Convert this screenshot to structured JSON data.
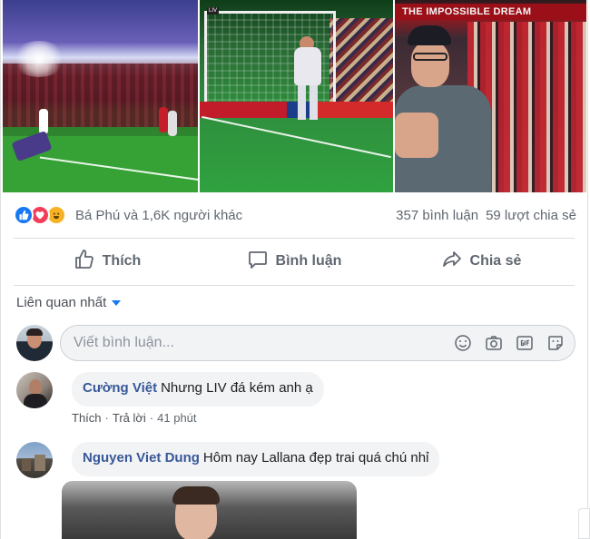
{
  "photos": [
    {
      "name": "stadium-photo"
    },
    {
      "name": "goal-celebration-photo",
      "badge": "LIV"
    },
    {
      "name": "manager-photo",
      "banner": "THE IMPOSSIBLE DREAM"
    }
  ],
  "stats": {
    "reactions": [
      "like-icon",
      "love-icon",
      "haha-icon"
    ],
    "reactors": "Bá Phú và 1,6K người khác",
    "comments": "357 bình luận",
    "shares": "59 lượt chia sẻ"
  },
  "actions": {
    "like": "Thích",
    "comment": "Bình luận",
    "share": "Chia sẻ"
  },
  "sort": {
    "label": "Liên quan nhất"
  },
  "composer": {
    "placeholder": "Viết bình luận...",
    "icons": [
      "emoji-icon",
      "camera-icon",
      "gif-icon",
      "sticker-icon"
    ]
  },
  "comments": [
    {
      "author": "Cường Việt",
      "text": "Nhưng LIV đá kém anh ạ",
      "like": "Thích",
      "sep": "·",
      "reply": "Trả lời",
      "time": "41 phút"
    },
    {
      "author": "Nguyen Viet Dung",
      "text": "Hôm nay Lallana đẹp trai quá chú nhỉ"
    }
  ],
  "colors": {
    "accent": "#1877f2",
    "author": "#385898",
    "muted": "#606770",
    "bubble": "#f2f3f5"
  }
}
